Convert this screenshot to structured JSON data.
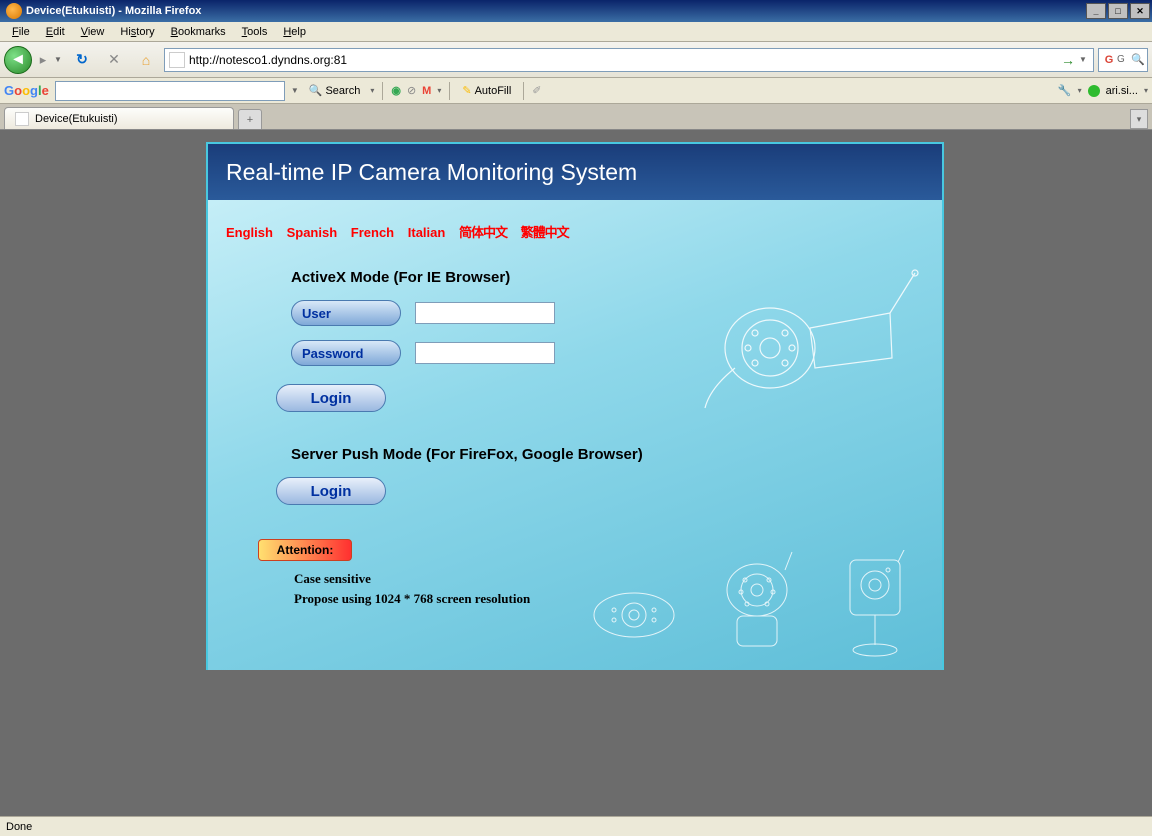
{
  "window": {
    "title": "Device(Etukuisti) - Mozilla Firefox"
  },
  "menu": [
    "File",
    "Edit",
    "View",
    "History",
    "Bookmarks",
    "Tools",
    "Help"
  ],
  "url": "http://notesco1.dyndns.org:81",
  "gtoolbar": {
    "logo": "Google",
    "search": "Search",
    "autofill": "AutoFill",
    "user": "ari.si..."
  },
  "tab": {
    "label": "Device(Etukuisti)"
  },
  "page": {
    "title": "Real-time IP Camera Monitoring System",
    "languages": [
      "English",
      "Spanish",
      "French",
      "Italian",
      "简体中文",
      "繁體中文"
    ],
    "section1": "ActiveX Mode (For IE Browser)",
    "user_label": "User",
    "password_label": "Password",
    "login_label": "Login",
    "section2": "Server Push Mode (For FireFox, Google Browser)",
    "attention": "Attention:",
    "note1": "Case sensitive",
    "note2": "Propose using 1024 * 768 screen resolution"
  },
  "status": "Done"
}
